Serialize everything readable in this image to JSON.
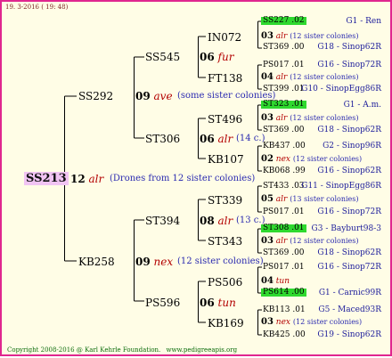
{
  "header": {
    "date": "19.  3-2016  ( 19: 48)"
  },
  "footer": {
    "copyright": "Copyright 2008-2016 @ Karl Kehrle Foundation.",
    "site": "www.pedigreeapis.org"
  },
  "root": {
    "id": "SS213",
    "mating_num": "12",
    "breed": "alr",
    "note": "(Drones from 12 sister colonies)"
  },
  "gen1": [
    {
      "id": "SS292",
      "mating_num": "09",
      "breed": "ave",
      "note": "(some sister colonies)"
    },
    {
      "id": "KB258",
      "mating_num": "09",
      "breed": "nex",
      "note": "(12 sister colonies)"
    }
  ],
  "gen2": [
    {
      "id": "SS545",
      "mating_num": "06",
      "breed": "fur",
      "note": ""
    },
    {
      "id": "ST306",
      "mating_num": "06",
      "breed": "alr",
      "note": "(14 c.)"
    },
    {
      "id": "ST394",
      "mating_num": "08",
      "breed": "alr",
      "note": "(13 c.)"
    },
    {
      "id": "PS596",
      "mating_num": "06",
      "breed": "tun",
      "note": ""
    }
  ],
  "gen3": [
    {
      "id": "IN072",
      "mating_num": "03",
      "breed": "alr",
      "note": "(12 sister colonies)"
    },
    {
      "id": "FT138",
      "mating_num": "04",
      "breed": "alr",
      "note": "(12 sister colonies)"
    },
    {
      "id": "ST496",
      "mating_num": "03",
      "breed": "alr",
      "note": "(12 sister colonies)"
    },
    {
      "id": "KB107",
      "mating_num": "02",
      "breed": "nex",
      "note": "(12 sister colonies)"
    },
    {
      "id": "ST339",
      "mating_num": "05",
      "breed": "alr",
      "note": "(13 sister colonies)"
    },
    {
      "id": "ST343",
      "mating_num": "03",
      "breed": "alr",
      "note": "(12 sister colonies)"
    },
    {
      "id": "PS506",
      "mating_num": "04",
      "breed": "tun",
      "note": ""
    },
    {
      "id": "KB169",
      "mating_num": "03",
      "breed": "nex",
      "note": "(12 sister colonies)"
    }
  ],
  "gen4": [
    {
      "id": "SS227 .02",
      "highlight": true,
      "pedigree": "G1 - Ren"
    },
    {
      "id": "ST369 .00",
      "highlight": false,
      "pedigree": "G18 - Sinop62R"
    },
    {
      "id": "PS017 .01",
      "highlight": false,
      "pedigree": "G16 - Sinop72R"
    },
    {
      "id": "ST399 .01",
      "highlight": false,
      "pedigree": "G10 - SinopEgg86R"
    },
    {
      "id": "ST323 .01",
      "highlight": true,
      "pedigree": "G1 - A.m."
    },
    {
      "id": "ST369 .00",
      "highlight": false,
      "pedigree": "G18 - Sinop62R"
    },
    {
      "id": "KB437 .00",
      "highlight": false,
      "pedigree": "G2 - Sinop96R"
    },
    {
      "id": "KB068 .99",
      "highlight": false,
      "pedigree": "G16 - Sinop62R"
    },
    {
      "id": "ST433 .03",
      "highlight": false,
      "pedigree": "G11 - SinopEgg86R"
    },
    {
      "id": "PS017 .01",
      "highlight": false,
      "pedigree": "G16 - Sinop72R"
    },
    {
      "id": "ST308 .01",
      "highlight": true,
      "pedigree": "G3 - Bayburt98-3"
    },
    {
      "id": "ST369 .00",
      "highlight": false,
      "pedigree": "G18 - Sinop62R"
    },
    {
      "id": "PS017 .01",
      "highlight": false,
      "pedigree": "G16 - Sinop72R"
    },
    {
      "id": "PS614 .00",
      "highlight": true,
      "pedigree": "G1 - Carnic99R"
    },
    {
      "id": "KB113 .01",
      "highlight": false,
      "pedigree": "G5 - Maced93R"
    },
    {
      "id": "KB425 .00",
      "highlight": false,
      "pedigree": "G19 - Sinop62R"
    }
  ]
}
